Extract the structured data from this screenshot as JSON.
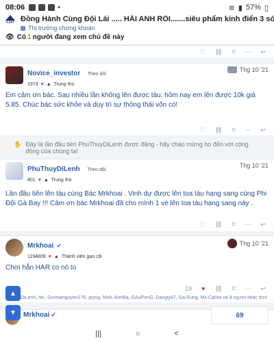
{
  "status": {
    "time": "08:06",
    "battery": "57%",
    "icons": [
      "facebook-icon",
      "facebook-icon",
      "messenger-icon",
      "dot-icon"
    ]
  },
  "header": {
    "logo_text": "F247",
    "title": "Đồng Hành Cùng Đội Lái ..... HÃI ANH RÕI.......siêu phẩm kinh điển 3 sóng",
    "subforum": "Thị trường chứng khoán"
  },
  "viewers": {
    "prefix": "Có",
    "count": "1",
    "suffix": "người đang xem chủ đề này"
  },
  "posts": [
    {
      "username": "Novice_investor",
      "follow": "Theo dõi",
      "points": "1973",
      "rank": "Trung thủ",
      "date": "Thg 10 '21",
      "body": "Em cảm ơn bác. Sau nhiều lần không lên được tàu, hôm nay em lên được 10k giá 5.85. Chúc bác sức khỏe và duy trì sự thông thái vốn có!",
      "like_count": ""
    },
    {
      "username": "PhuThuyDiLenh",
      "follow": "Theo dõi",
      "points": "801",
      "rank": "Trung thủ",
      "date": "Thg 10 '21",
      "body": "Lần đầu tiên lên tàu cùng Bác Mrkhoai . Vinh dự được lên toa tàu hạng sang cùng Phi Đội Gà Bay !!! Cảm ơn bác Mrkhoai đã cho mình 1 vé lên toa tàu hạng sang này .",
      "like_count": ""
    },
    {
      "username": "Mrkhoai",
      "follow": "",
      "points": "1194808",
      "rank": "Thành viên gạo cội",
      "date": "Thg 10 '21",
      "body": "Chơi hẳn HAR co nó to",
      "like_count": "19"
    },
    {
      "username": "Mrkhoai",
      "follow": "",
      "points": "",
      "rank": "",
      "date": "",
      "body": "",
      "like_count": ""
    }
  ],
  "notice": "Đây là lần đầu tiên PhuThuyDiLenh được đăng - hãy chào mừng họ đến với cộng đồng của chúng ta!",
  "likes_line": "DiLenh, hlc, Sonhainguyen176, jayng, Mofi, AnhBa, GAuPonG, Dangly87, Ga.Rung, Ms.CaHoi và 9 người khác thích bài này",
  "pager": {
    "current": "69"
  },
  "navbar": {
    "recent": "|||",
    "home": "○",
    "back": "<"
  }
}
